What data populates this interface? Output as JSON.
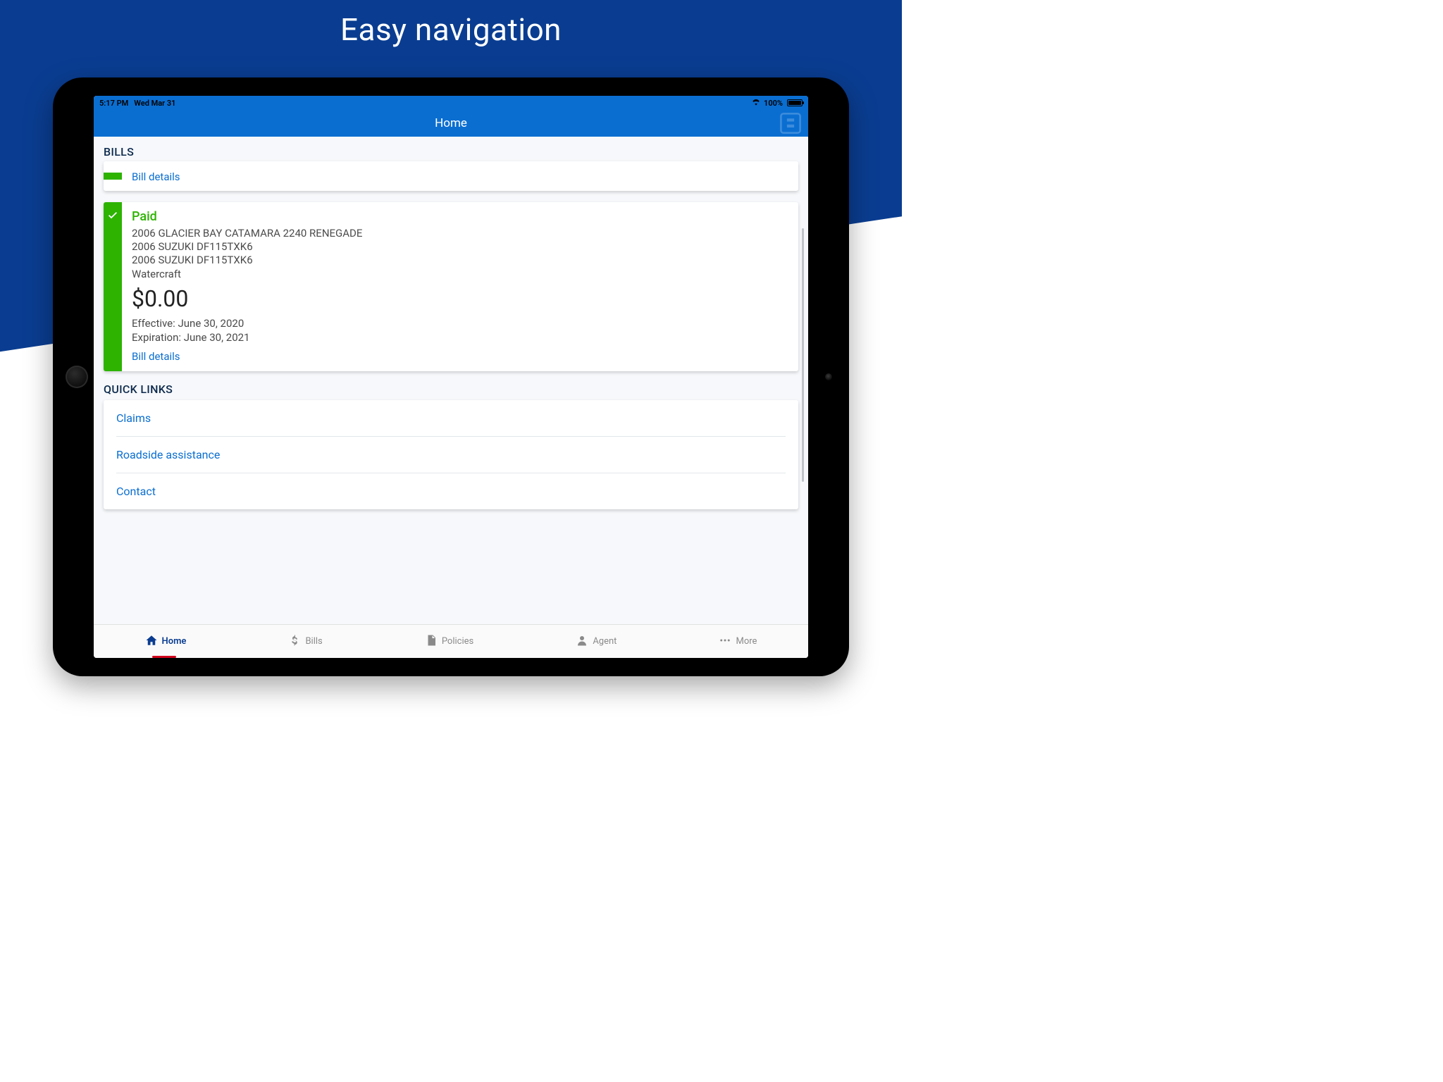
{
  "promo": {
    "title": "Easy navigation"
  },
  "statusbar": {
    "time": "5:17 PM",
    "date": "Wed Mar 31",
    "battery_pct": "100%"
  },
  "header": {
    "title": "Home"
  },
  "bills": {
    "section_label": "BILLS",
    "mini_card": {
      "link": "Bill details"
    },
    "paid_card": {
      "status": "Paid",
      "vehicles": [
        "2006 GLACIER BAY CATAMARA 2240 RENEGADE",
        "2006 SUZUKI DF115TXK6",
        "2006 SUZUKI DF115TXK6"
      ],
      "category": "Watercraft",
      "amount": "$0.00",
      "effective": "Effective: June 30, 2020",
      "expiration": "Expiration: June 30, 2021",
      "link": "Bill details"
    }
  },
  "quicklinks": {
    "section_label": "QUICK LINKS",
    "items": [
      "Claims",
      "Roadside assistance",
      "Contact"
    ]
  },
  "tabs": [
    {
      "label": "Home",
      "icon": "home-icon"
    },
    {
      "label": "Bills",
      "icon": "dollar-icon"
    },
    {
      "label": "Policies",
      "icon": "document-icon"
    },
    {
      "label": "Agent",
      "icon": "person-icon"
    },
    {
      "label": "More",
      "icon": "more-icon"
    }
  ]
}
